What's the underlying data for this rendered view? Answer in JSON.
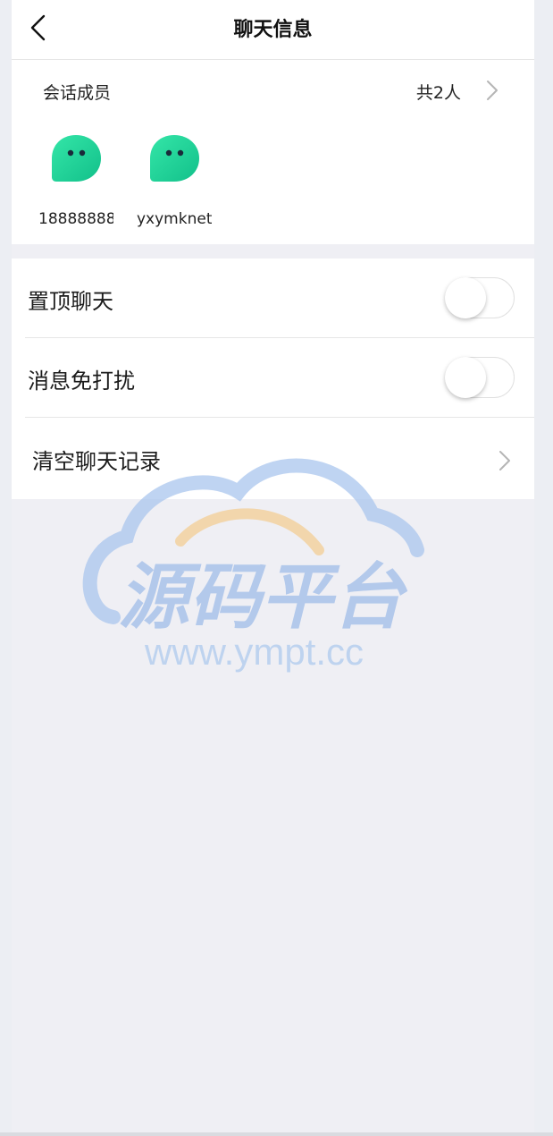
{
  "header": {
    "title": "聊天信息",
    "back_icon": "chevron-left-icon"
  },
  "members_section": {
    "label": "会话成员",
    "count_text": "共2人",
    "chevron_icon": "chevron-right-icon",
    "members": [
      {
        "name": "18888888",
        "avatar_icon": "chat-bubble-avatar-icon"
      },
      {
        "name": "yxymknet",
        "avatar_icon": "chat-bubble-avatar-icon"
      }
    ]
  },
  "settings": {
    "pin_chat": {
      "label": "置顶聊天",
      "enabled": false
    },
    "mute_notifications": {
      "label": "消息免打扰",
      "enabled": false
    },
    "clear_history": {
      "label": "清空聊天记录"
    }
  },
  "watermark": {
    "title": "源码平台",
    "url": "www.ympt.cc"
  },
  "colors": {
    "avatar_green_start": "#2ce0a0",
    "avatar_green_end": "#14c48a",
    "background": "#efeff4",
    "card": "#ffffff",
    "watermark_blue": "#a9c6ee",
    "watermark_orange": "#f3cf9a"
  }
}
